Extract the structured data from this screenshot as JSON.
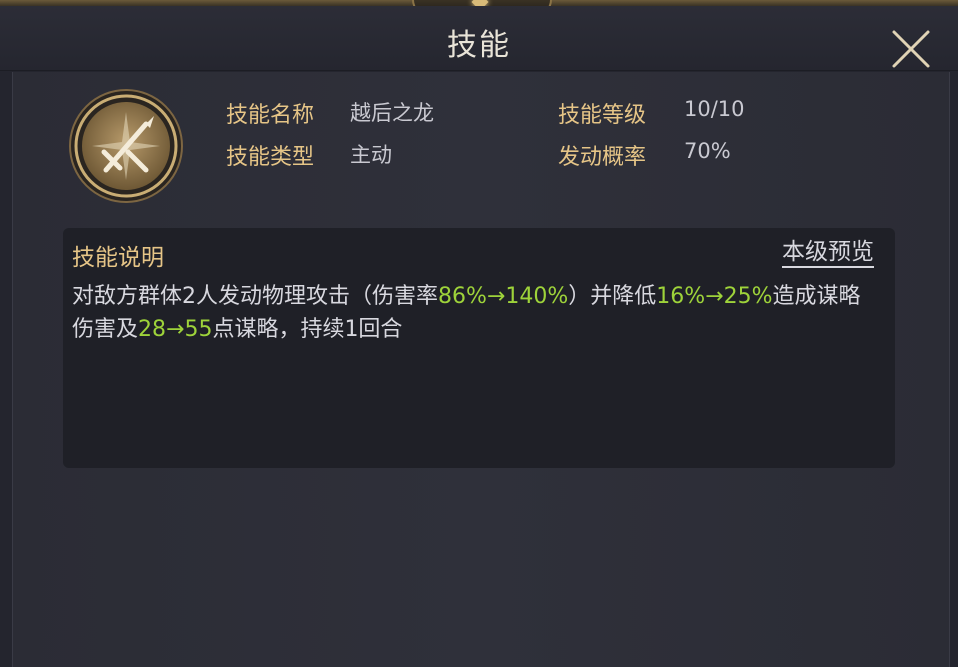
{
  "header": {
    "title": "技能"
  },
  "skill": {
    "icon": "crossed-swords-icon",
    "name_label": "技能名称",
    "name_value": "越后之龙",
    "level_label": "技能等级",
    "level_value": "10/10",
    "type_label": "技能类型",
    "type_value": "主动",
    "rate_label": "发动概率",
    "rate_value": "70%"
  },
  "description": {
    "title": "技能说明",
    "preview_label": "本级预览",
    "seg1": "对敌方群体2人发动物理攻击（伤害率",
    "hl1": "86%→140%",
    "seg2": "）并降低",
    "hl2": "16%→25%",
    "seg3": "造成谋略伤害及",
    "hl3": "28→55",
    "seg4": "点谋略，持续1回合"
  },
  "colors": {
    "label_gold": "#e6c587",
    "highlight_green": "#9ed33a",
    "background": "#24252e"
  }
}
